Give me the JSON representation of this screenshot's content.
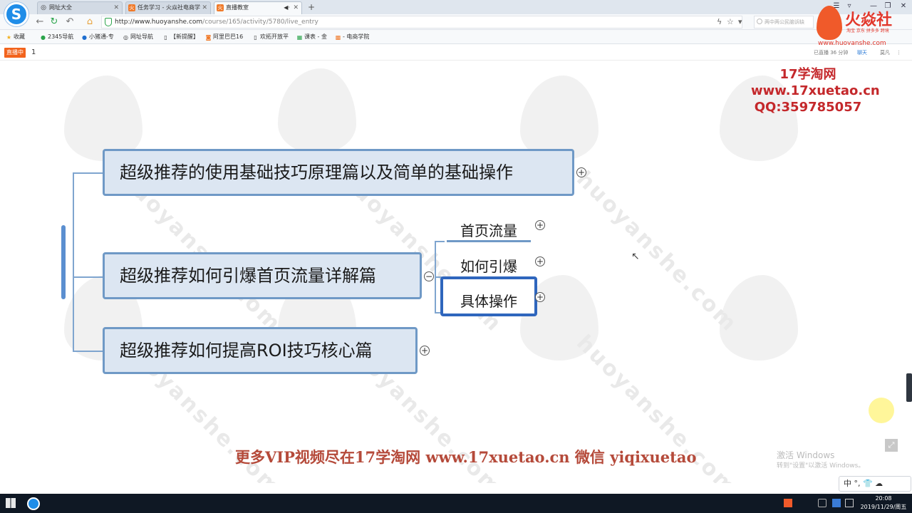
{
  "browser": {
    "tabs": [
      {
        "title": "网址大全",
        "icon": "globe-icon"
      },
      {
        "title": "任务学习 - 火焱社电商学",
        "icon": "huoyan-favicon-icon"
      },
      {
        "title": "直播教室",
        "icon": "huoyan-favicon-icon",
        "audio": "◀·"
      }
    ],
    "new_tab": "+",
    "window_controls": [
      "☰",
      "▿",
      "—",
      "❐",
      "✕"
    ],
    "address": {
      "host": "http://www.huoyanshe.com",
      "path": "/course/165/activity/5780/live_entry"
    },
    "search_placeholder": "两中两公民脑诉缺",
    "bookmarks": [
      "收藏",
      "2345导航",
      "小猪通-专",
      "网址导航",
      "【新提醒】",
      "阿里巴巴16",
      "欢拓开放平",
      "课表 - 金",
      "- 电商学院"
    ]
  },
  "live": {
    "badge": "直播中",
    "count": "1",
    "duration": "已直播 36 分钟",
    "chat": "聊天",
    "user": "莫凡"
  },
  "brand": {
    "name": "火焱社",
    "slogan": "淘宝 京东 拼多多 跨境",
    "url": "www.huoyanshe.com"
  },
  "promo": {
    "line1": "17学淘网",
    "line2": "www.17xuetao.cn",
    "line3": "QQ:359785057"
  },
  "mindmap": {
    "nodes": [
      {
        "label": "超级推荐的使用基础技巧原理篇以及简单的基础操作",
        "expander": "+"
      },
      {
        "label": "超级推荐如何引爆首页流量详解篇",
        "expander": "−"
      },
      {
        "label": "超级推荐如何提高ROI技巧核心篇",
        "expander": "+"
      }
    ],
    "subnodes": [
      {
        "label": "首页流量",
        "expander": "+"
      },
      {
        "label": "如何引爆",
        "expander": "+"
      },
      {
        "label": "具体操作",
        "expander": "+"
      }
    ]
  },
  "caption": "更多VIP视频尽在17学淘网  www.17xuetao.cn  微信 yiqixuetao",
  "watermark": "huoyanshe.com",
  "system": {
    "activate_windows": "激活 Windows",
    "activate_sub": "转到\"设置\"以激活 Windows。",
    "ime": "中 °, 👕 ☁",
    "time": "20:08",
    "date": "2019/11/29/周五"
  },
  "colors": {
    "node_border": "#6f99c6",
    "node_fill": "#dce6f2",
    "promo_red": "#c4282b",
    "live_orange": "#f2631c"
  }
}
